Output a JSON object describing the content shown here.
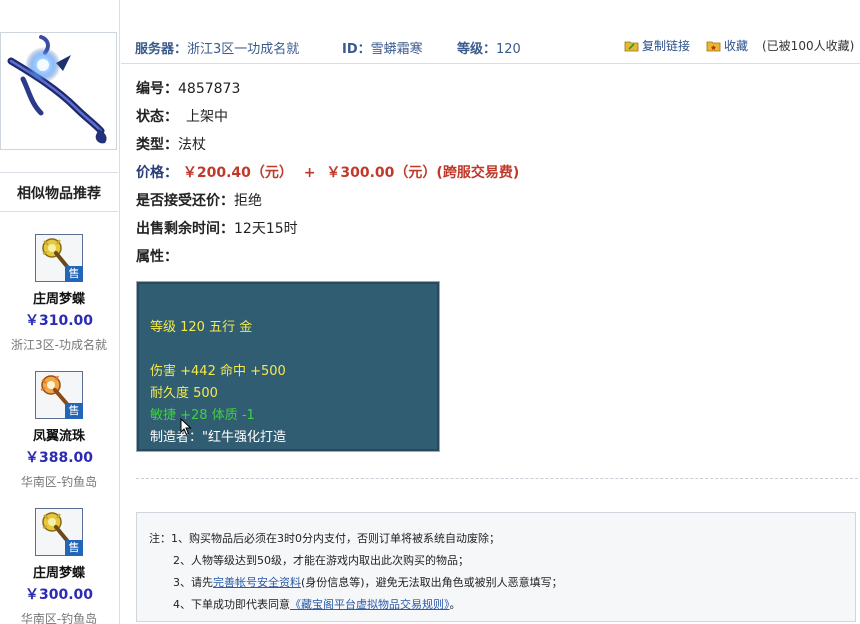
{
  "header": {
    "server_label": "服务器：",
    "server_value": "浙江3区一功成名就",
    "id_label": "ID：",
    "id_value": "雪蟒霜寒",
    "level_label": "等级：",
    "level_value": "120",
    "copy_link": "复制链接",
    "collect": "收藏",
    "collected_badge": "(已被100人收藏)"
  },
  "item": {
    "number_label": "编号：",
    "number_value": "4857873",
    "status_label": "状态：",
    "status_value": "上架中",
    "type_label": "类型：",
    "type_value": "法杖",
    "price_label": "价格：",
    "price_value": "￥200.40（元）",
    "plus": "+",
    "fee_value": "￥300.00（元）(跨服交易费)",
    "bargain_label": "是否接受还价：",
    "bargain_value": "拒绝",
    "time_label": "出售剩余时间：",
    "time_value": "12天15时",
    "attr_label": "属性："
  },
  "attributes": {
    "line1": "等级 120 五行 金",
    "line2": "伤害 +442 命中 +500",
    "line3": "耐久度 500",
    "line4": "敏捷 +28 体质 -1",
    "line5": "制造者：\"红牛强化打造"
  },
  "similar": {
    "title": "相似物品推荐",
    "sale_tag": "售",
    "items": [
      {
        "name": "庄周梦蝶",
        "price": "￥310.00",
        "server": "浙江3区-功成名就"
      },
      {
        "name": "凤翼流珠",
        "price": "￥388.00",
        "server": "华南区-钓鱼岛"
      },
      {
        "name": "庄周梦蝶",
        "price": "￥300.00",
        "server": "华南区-钓鱼岛"
      }
    ]
  },
  "notes": {
    "line1": "注：1、购买物品后必须在3时0分内支付，否则订单将被系统自动废除；",
    "line2": "2、人物等级达到50级，才能在游戏内取出此次购买的物品；",
    "line3_pre": "3、请先",
    "line3_link": "完善帐号安全资料",
    "line3_post": "(身份信息等)，避免无法取出角色或被别人恶意填写；",
    "line4_pre": "4、下单成功即代表同意",
    "line4_link": "《藏宝阁平台虚拟物品交易规则》",
    "line4_post": "。"
  },
  "colors": {
    "price": "#c0392b",
    "similar_price": "#2b2bb3",
    "attr_bg": "#315d73",
    "attr_yellow": "#f2e94a",
    "attr_green": "#3fd13f"
  }
}
